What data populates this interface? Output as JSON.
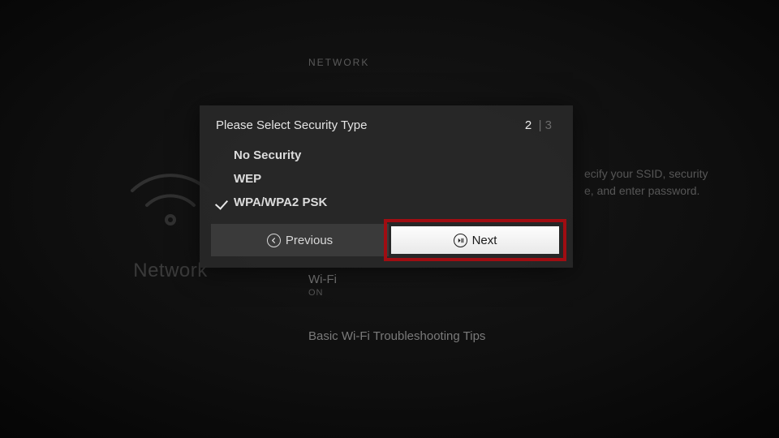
{
  "page": {
    "header": "NETWORK",
    "hint_line1": "ecify your SSID, security",
    "hint_line2": "e, and enter password.",
    "wifi_title": "Wi-Fi",
    "wifi_status": "ON",
    "troubleshoot": "Basic Wi-Fi Troubleshooting Tips",
    "left_label": "Network"
  },
  "dialog": {
    "title": "Please Select Security Type",
    "step_current": "2",
    "step_total": "3",
    "options": {
      "none": "No Security",
      "wep": "WEP",
      "wpa": "WPA/WPA2 PSK"
    },
    "selected": "wpa",
    "prev_label": "Previous",
    "next_label": "Next"
  }
}
